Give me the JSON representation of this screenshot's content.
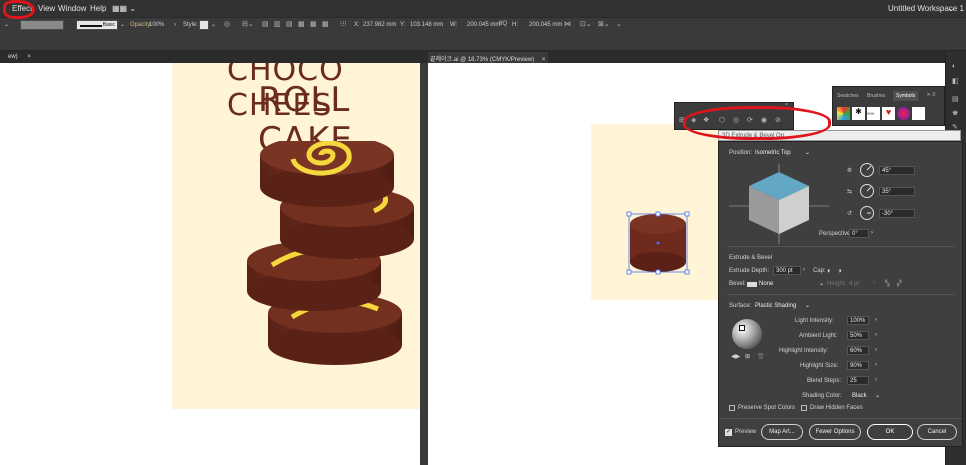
{
  "menu": {
    "items": [
      "Effect",
      "View",
      "Window",
      "Help"
    ],
    "workspace": "Untitled Workspace 1"
  },
  "control": {
    "stroke_label": "Basic",
    "opacity_label": "Opacity:",
    "opacity_value": "100%",
    "style_label": "Style:",
    "x_value": "237.982 mm",
    "y_value": "103.148 mm",
    "w_label": "W:",
    "w_value": "200.045 mm",
    "h_value": "200.045 mm"
  },
  "tabs": {
    "left": "ew)",
    "right": "끝레이크.ai @ 18.73% (CMYK/Preview)"
  },
  "artwork": {
    "title_line1": "CHOCO CHEES",
    "title_line2": "ROLL CAKE"
  },
  "swatches_panel": {
    "tabs": [
      "Swatches",
      "Brushes",
      "Symbols"
    ]
  },
  "tooltip": "3D Extrude & Bevel Op",
  "dialog": {
    "position_label": "Position:",
    "position_value": "Isometric Top",
    "angle_x": "45°",
    "angle_y": "35°",
    "angle_z": "-30°",
    "perspective_label": "Perspective:",
    "perspective_value": "0°",
    "extrude_section": "Extrude & Bevel",
    "extrude_depth_label": "Extrude Depth:",
    "extrude_depth_value": "300 pt",
    "cap_label": "Cap:",
    "bevel_label": "Bevel:",
    "bevel_value": "None",
    "height_label": "Height:",
    "height_value": "4 pt",
    "surface_label": "Surface:",
    "surface_value": "Plastic Shading",
    "light_intensity_label": "Light Intensity:",
    "light_intensity_value": "100%",
    "ambient_light_label": "Ambient Light:",
    "ambient_light_value": "50%",
    "highlight_intensity_label": "Highlight Intensity:",
    "highlight_intensity_value": "60%",
    "highlight_size_label": "Highlight Size:",
    "highlight_size_value": "90%",
    "blend_steps_label": "Blend Steps:",
    "blend_steps_value": "25",
    "shading_color_label": "Shading Color:",
    "shading_color_value": "Black",
    "preserve_spot_label": "Preserve Spot Colors",
    "draw_hidden_label": "Draw Hidden Faces",
    "preview_label": "Preview",
    "map_art_label": "Map Art...",
    "fewer_options_label": "Fewer Options",
    "ok_label": "OK",
    "cancel_label": "Cancel"
  }
}
